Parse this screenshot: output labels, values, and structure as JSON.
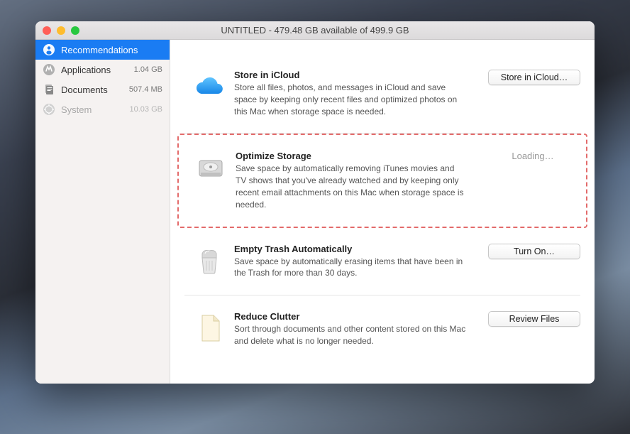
{
  "window": {
    "title": "UNTITLED - 479.48 GB available of 499.9 GB"
  },
  "sidebar": {
    "items": [
      {
        "label": "Recommendations",
        "size": ""
      },
      {
        "label": "Applications",
        "size": "1.04 GB"
      },
      {
        "label": "Documents",
        "size": "507.4 MB"
      },
      {
        "label": "System",
        "size": "10.03 GB"
      }
    ]
  },
  "recommendations": [
    {
      "title": "Store in iCloud",
      "desc": "Store all files, photos, and messages in iCloud and save space by keeping only recent files and optimized photos on this Mac when storage space is needed.",
      "button": "Store in iCloud…"
    },
    {
      "title": "Optimize Storage",
      "desc": "Save space by automatically removing iTunes movies and TV shows that you've already watched and by keeping only recent email attachments on this Mac when storage space is needed.",
      "loading": "Loading…"
    },
    {
      "title": "Empty Trash Automatically",
      "desc": "Save space by automatically erasing items that have been in the Trash for more than 30 days.",
      "button": "Turn On…"
    },
    {
      "title": "Reduce Clutter",
      "desc": "Sort through documents and other content stored on this Mac and delete what is no longer needed.",
      "button": "Review Files"
    }
  ]
}
